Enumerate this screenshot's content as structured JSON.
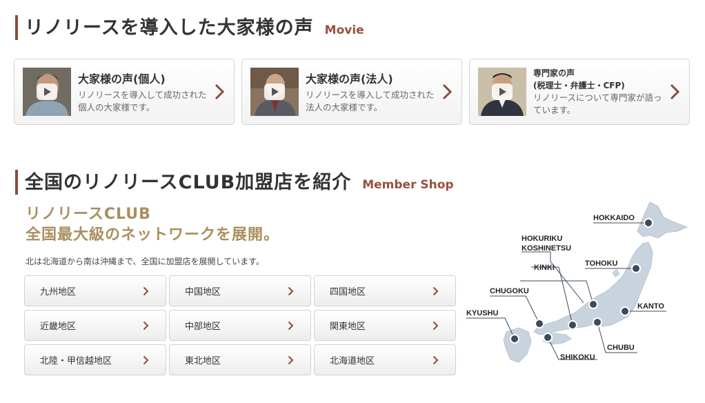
{
  "voices": {
    "title": "リノリースを導入した大家様の声",
    "subtitle": "Movie",
    "cards": [
      {
        "title": "大家様の声(個人)",
        "desc": "リノリースを導入して成功された個人の大家様です。"
      },
      {
        "title": "大家様の声(法人)",
        "desc": "リノリースを導入して成功された法人の大家様です。"
      },
      {
        "title": "専門家の声",
        "title2": "(税理士・弁護士・CFP)",
        "desc": "リノリースについて専門家が語っています。"
      }
    ]
  },
  "shops": {
    "title": "全国のリノリースCLUB加盟店を紹介",
    "subtitle": "Member Shop",
    "tagline_1": "リノリースCLUB",
    "tagline_2": "全国最大級のネットワークを展開。",
    "intro": "北は北海道から南は沖縄まで、全国に加盟店を展開しています。",
    "regions": [
      "九州地区",
      "中国地区",
      "四国地区",
      "近畿地区",
      "中部地区",
      "関東地区",
      "北陸・甲信越地区",
      "東北地区",
      "北海道地区"
    ]
  },
  "map": {
    "labels": {
      "hokkaido": "HOKKAIDO",
      "hokuriku_1": "HOKURIKU",
      "hokuriku_2": "KOSHINETSU",
      "tohoku": "TOHOKU",
      "kinki": "KINKI",
      "chugoku": "CHUGOKU",
      "kanto": "KANTO",
      "kyushu": "KYUSHU",
      "chubu": "CHUBU",
      "shikoku": "SHIKOKU"
    }
  },
  "colors": {
    "accent": "#8b4a3c",
    "gold": "#a88f5e",
    "map_land": "#c9d3de",
    "map_dot": "#3d4a5c"
  }
}
